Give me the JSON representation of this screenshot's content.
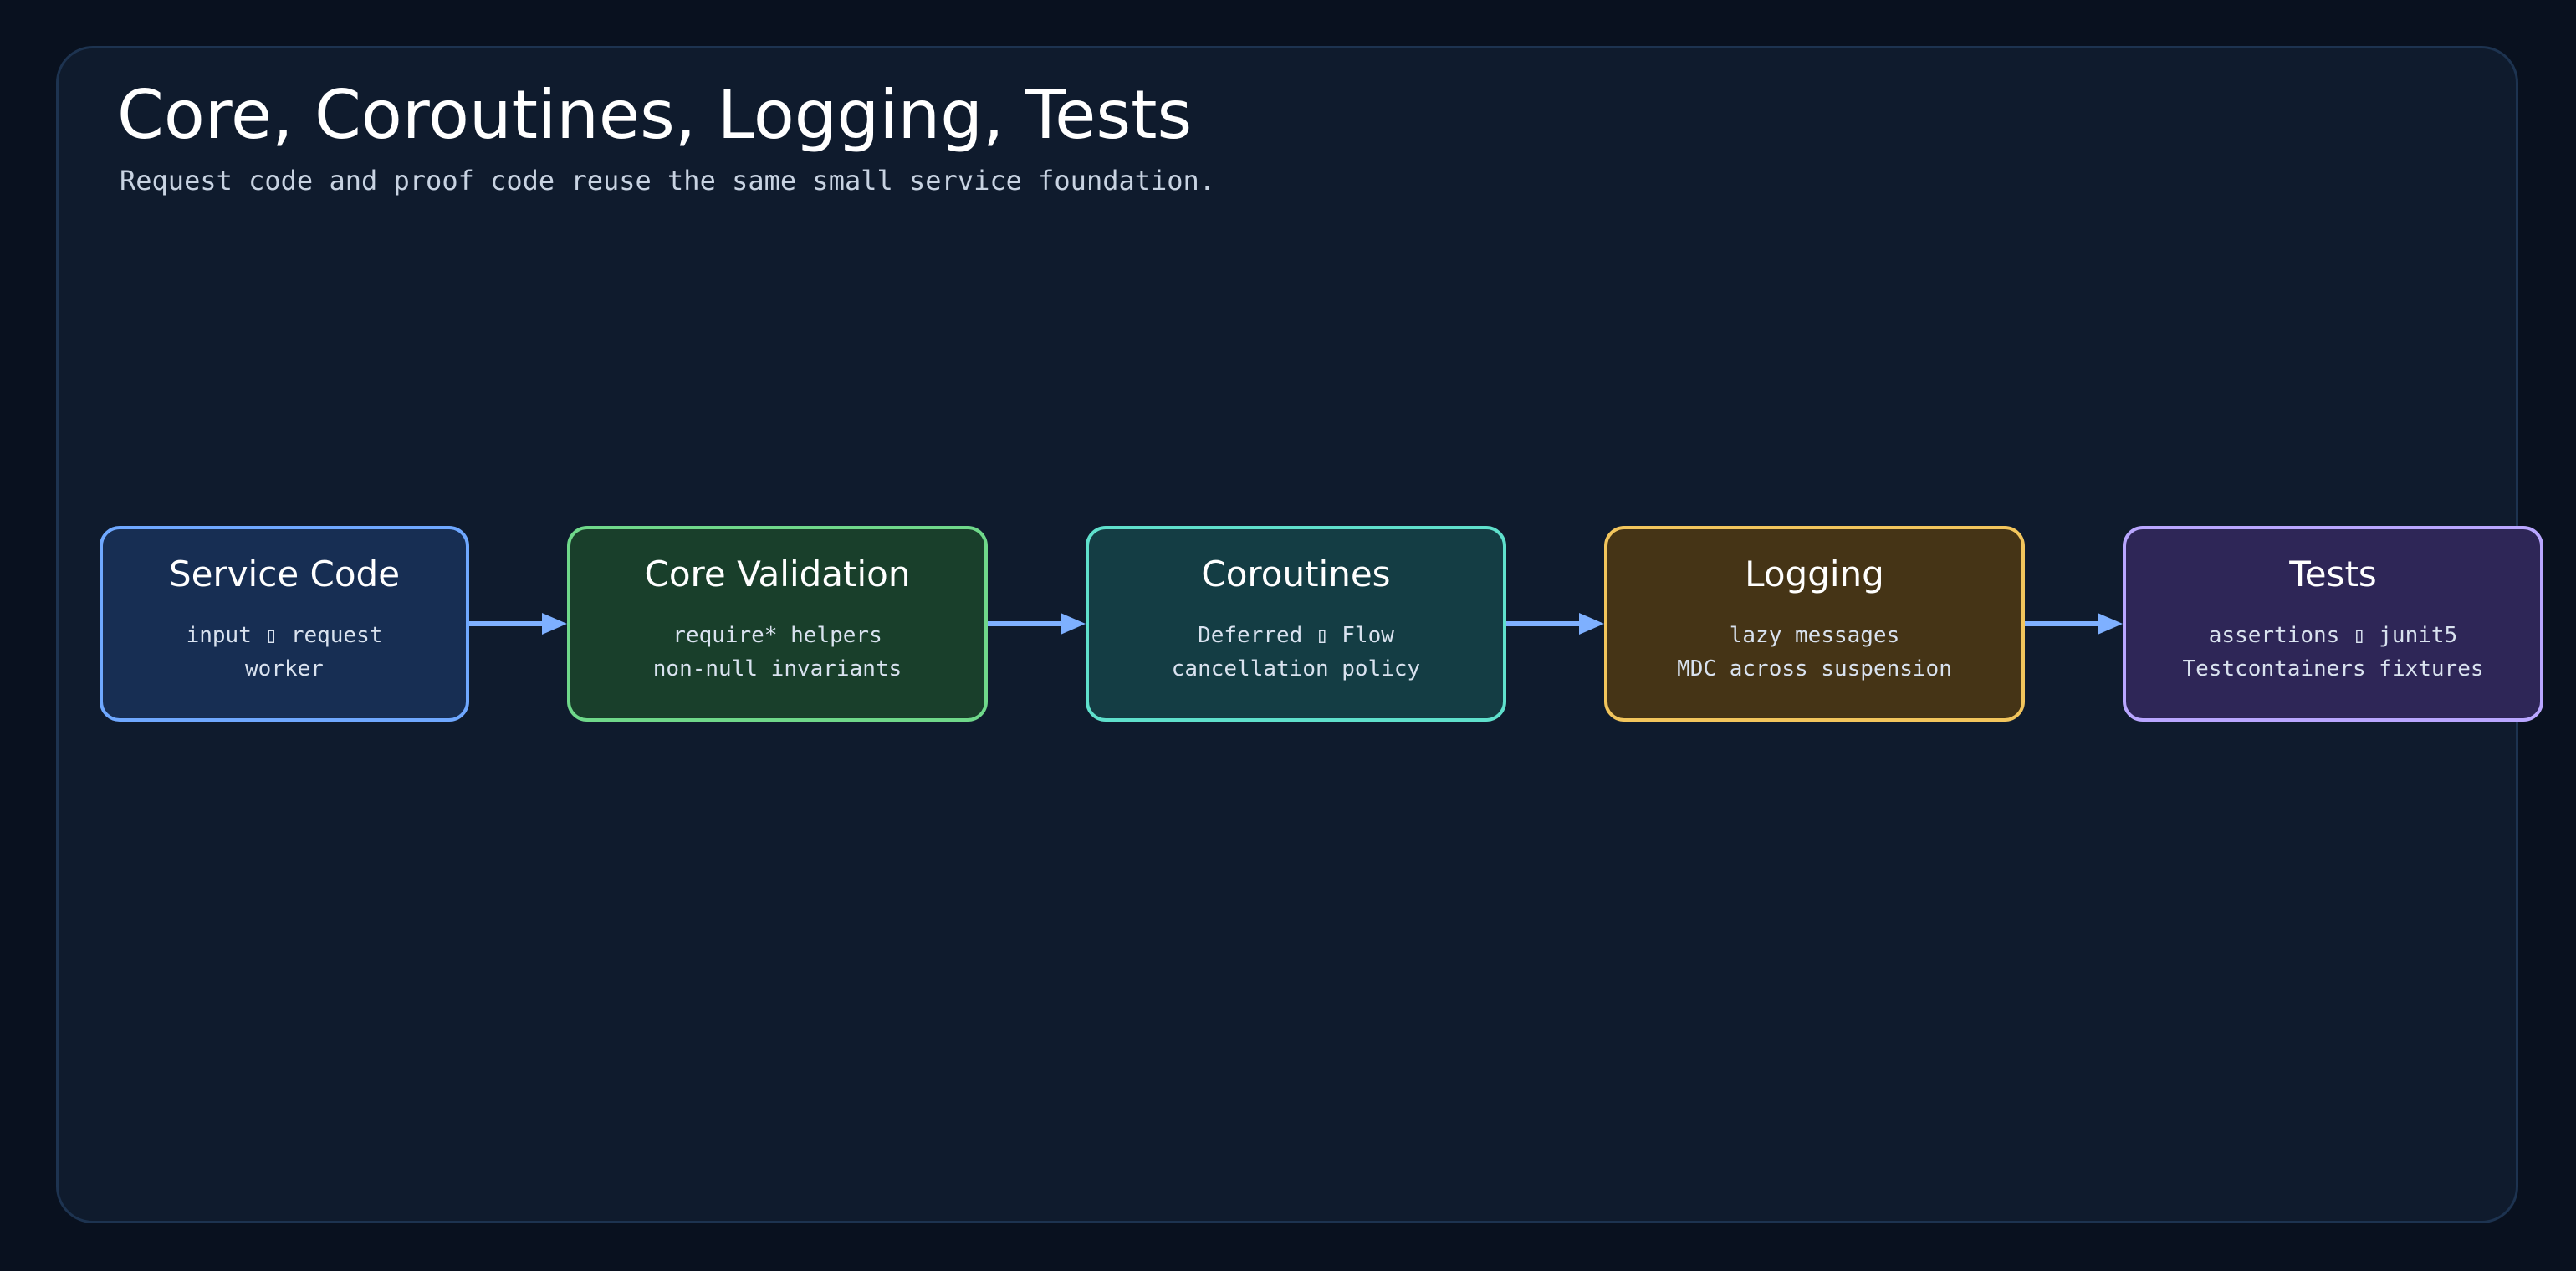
{
  "diagram": {
    "title": "Core, Coroutines, Logging, Tests",
    "subtitle": "Request code and proof code reuse the same small service foundation.",
    "nodes": [
      {
        "id": "service-code",
        "title": "Service Code",
        "lines": [
          "input ▯ request",
          "worker"
        ],
        "border": "#6fa8ff",
        "fill": "#172e53"
      },
      {
        "id": "core-validation",
        "title": "Core Validation",
        "lines": [
          "require* helpers",
          "non-null invariants"
        ],
        "border": "#6fd88a",
        "fill": "#193f2b"
      },
      {
        "id": "coroutines",
        "title": "Coroutines",
        "lines": [
          "Deferred ▯ Flow",
          "cancellation policy"
        ],
        "border": "#5fe0cc",
        "fill": "#143d44"
      },
      {
        "id": "logging",
        "title": "Logging",
        "lines": [
          "lazy messages",
          "MDC across suspension"
        ],
        "border": "#f2c55c",
        "fill": "#453416"
      },
      {
        "id": "tests",
        "title": "Tests",
        "lines": [
          "assertions ▯ junit5",
          "Testcontainers fixtures"
        ],
        "border": "#b9a6ff",
        "fill": "#2e2657"
      }
    ],
    "edges": [
      {
        "from": "service-code",
        "to": "core-validation"
      },
      {
        "from": "core-validation",
        "to": "coroutines"
      },
      {
        "from": "coroutines",
        "to": "logging"
      },
      {
        "from": "logging",
        "to": "tests"
      }
    ],
    "colors": {
      "background": "#09111f",
      "panel": "#0f1b2d",
      "panel_border": "#1d3350",
      "edge": "#7eb0ff"
    }
  }
}
